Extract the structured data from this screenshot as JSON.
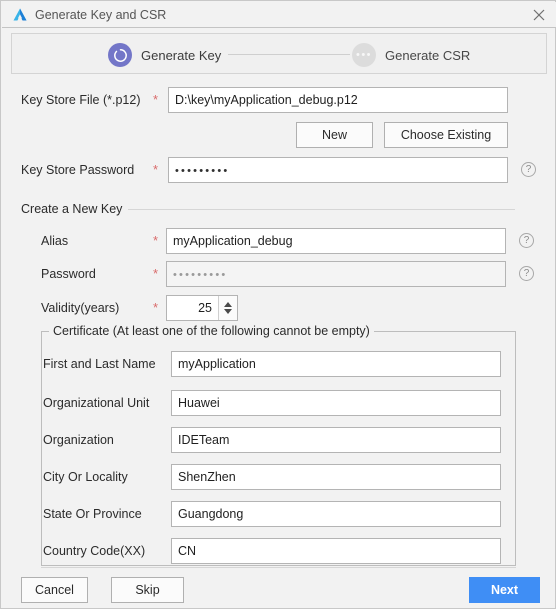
{
  "window": {
    "title": "Generate Key and CSR",
    "app_icon": "deveco-logo-icon",
    "close_icon": "close-icon"
  },
  "stepper": {
    "steps": [
      {
        "label": "Generate Key",
        "state": "active",
        "icon": "spinner-ring-icon"
      },
      {
        "label": "Generate CSR",
        "state": "inactive",
        "icon": "ellipsis-icon"
      }
    ],
    "active_color": "#7376c8",
    "inactive_color": "#dcdcdc"
  },
  "form": {
    "key_store_file": {
      "label": "Key Store File (*.p12)",
      "required_mark": "*",
      "value": "D:\\key\\myApplication_debug.p12",
      "placeholder": ""
    },
    "new_button": "New",
    "choose_existing_button": "Choose Existing",
    "key_store_password": {
      "label": "Key Store Password",
      "required_mark": "*",
      "value": "•••••••••",
      "help_icon": "help-icon"
    },
    "section_title": "Create a New Key",
    "alias": {
      "label": "Alias",
      "required_mark": "*",
      "value": "myApplication_debug",
      "help_icon": "help-icon"
    },
    "password": {
      "label": "Password",
      "required_mark": "*",
      "value": "•••••••••",
      "help_icon": "help-icon"
    },
    "validity": {
      "label": "Validity(years)",
      "required_mark": "*",
      "value": "25",
      "increment_icon": "arrow-up-icon",
      "decrement_icon": "arrow-down-icon"
    }
  },
  "certificate": {
    "group_title": "Certificate (At least one of the following cannot be empty)",
    "fields": [
      {
        "label": "First and Last Name",
        "value": "myApplication"
      },
      {
        "label": "Organizational Unit",
        "value": "Huawei"
      },
      {
        "label": "Organization",
        "value": "IDETeam"
      },
      {
        "label": "City Or Locality",
        "value": "ShenZhen"
      },
      {
        "label": "State Or Province",
        "value": "Guangdong"
      },
      {
        "label": "Country Code(XX)",
        "value": "CN"
      }
    ]
  },
  "footer": {
    "cancel": "Cancel",
    "skip": "Skip",
    "next": "Next",
    "primary_color": "#3f8ef5"
  }
}
